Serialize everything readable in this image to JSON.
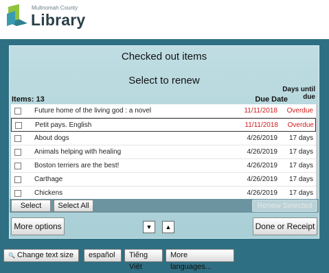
{
  "library": {
    "county": "Multnomah County",
    "name": "Library"
  },
  "panel": {
    "title": "Checked out items",
    "subtitle": "Select to renew",
    "items_label": "Items: 13",
    "col_due": "Due Date",
    "col_days": "Days until due"
  },
  "items": [
    {
      "title": "Future home of the living god : a novel",
      "due": "11/11/2018",
      "days": "Overdue",
      "overdue": true
    },
    {
      "title": "Petit pays. English",
      "due": "11/11/2018",
      "days": "Overdue",
      "overdue": true
    },
    {
      "title": "About dogs",
      "due": "4/26/2019",
      "days": "17 days",
      "overdue": false
    },
    {
      "title": "Animals helping with healing",
      "due": "4/26/2019",
      "days": "17 days",
      "overdue": false
    },
    {
      "title": "Boston terriers are the best!",
      "due": "4/26/2019",
      "days": "17 days",
      "overdue": false
    },
    {
      "title": "Carthage",
      "due": "4/26/2019",
      "days": "17 days",
      "overdue": false
    },
    {
      "title": "Chickens",
      "due": "4/26/2019",
      "days": "17 days",
      "overdue": false
    }
  ],
  "buttons": {
    "select": "Select",
    "select_all": "Select All",
    "renew_selected": "Renew Selected",
    "more_options": "More options",
    "done": "Done or Receipt",
    "down": "▼",
    "up": "▲"
  },
  "footer": {
    "change_text": "Change text size",
    "espanol": "español",
    "tieng_viet": "Tiếng Việt",
    "more_languages": "More languages..."
  },
  "colors": {
    "accent": "#2f6f83",
    "overdue": "#d11a1a"
  }
}
